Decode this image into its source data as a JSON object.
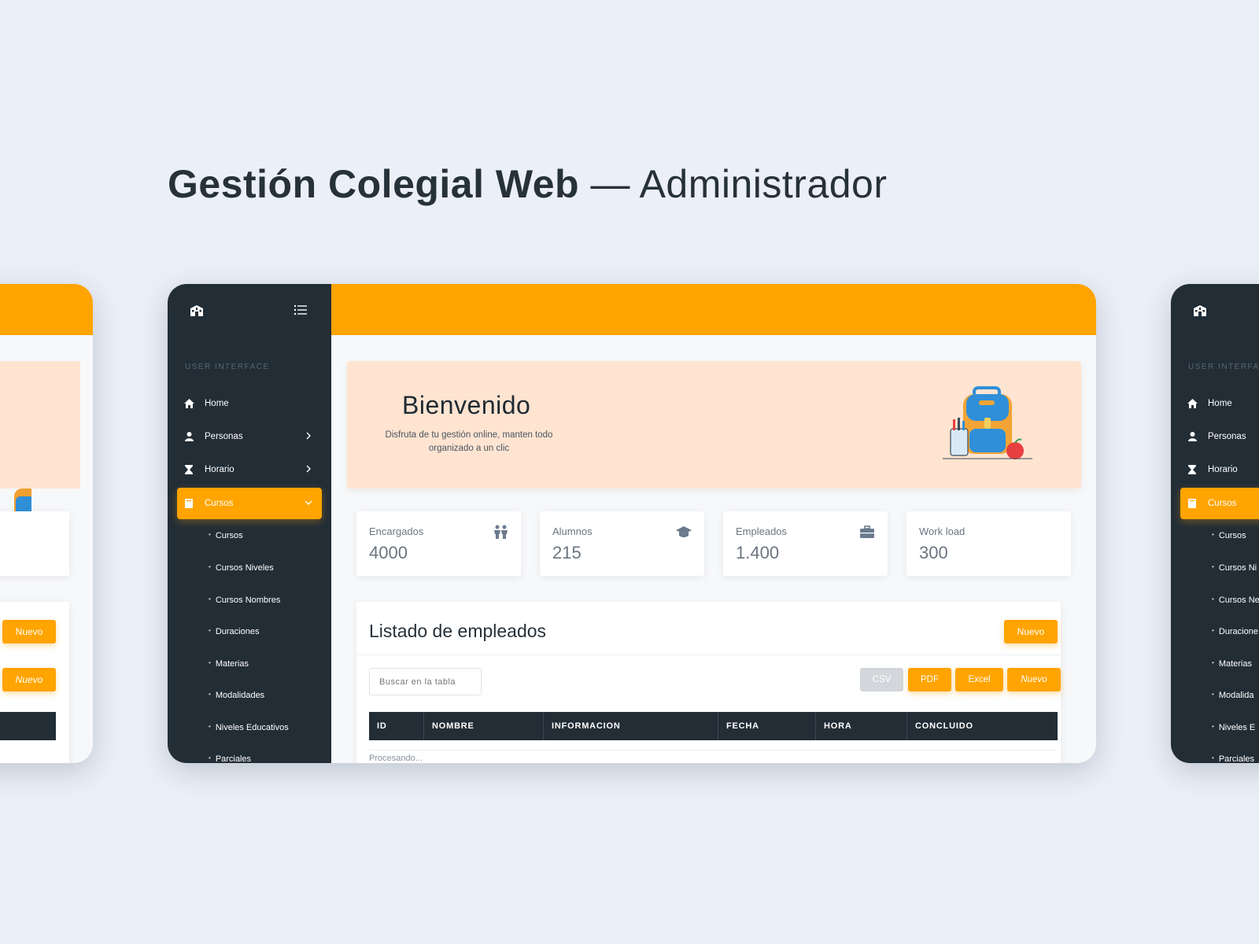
{
  "headline": {
    "strong": "Gestión Colegial Web",
    "light": " — Administrador"
  },
  "sidebar": {
    "section": "USER INTERFACE",
    "items": [
      {
        "label": "Home",
        "icon": "home-icon"
      },
      {
        "label": "Personas",
        "icon": "user-icon"
      },
      {
        "label": "Horario",
        "icon": "hourglass-icon"
      },
      {
        "label": "Cursos",
        "icon": "book-icon"
      }
    ],
    "subitems": [
      "Cursos",
      "Cursos Niveles",
      "Cursos Nombres",
      "Duraciones",
      "Materias",
      "Modalidades",
      "Niveles Educativos",
      "Parciales"
    ]
  },
  "right_sidebar_items": {
    "subitems": [
      "Cursos",
      "Cursos Ni",
      "Cursos Ne",
      "Duracione",
      "Materias",
      "Modalida",
      "Niveles E",
      "Parciales"
    ],
    "section": "USER INTERFAC"
  },
  "welcome": {
    "title": "Bienvenido",
    "subtitle": "Disfruta de tu gestión online, manten todo organizado a un clic"
  },
  "stats": [
    {
      "label": "Encargados",
      "value": "4000",
      "icon": "parents-icon"
    },
    {
      "label": "Alumnos",
      "value": "215",
      "icon": "graduation-cap-icon"
    },
    {
      "label": "Empleados",
      "value": "1.400",
      "icon": "briefcase-icon"
    },
    {
      "label": "Work load",
      "value": "300",
      "icon": ""
    }
  ],
  "employees": {
    "title": "Listado de empleados",
    "new_label": "Nuevo",
    "search_placeholder": "Buscar en la tabla",
    "export": {
      "csv": "CSV",
      "pdf": "PDF",
      "excel": "Excel",
      "nuevo": "Nuevo"
    },
    "columns": [
      "ID",
      "NOMBRE",
      "INFORMACION",
      "FECHA",
      "HORA",
      "CONCLUIDO"
    ],
    "processing": "Procesando..."
  },
  "left_preview": {
    "btn1": "Nuevo",
    "btn2": "Nuevo"
  },
  "colors": {
    "accent": "#ffa400",
    "sidebar": "#222d36",
    "welcome_bg": "#ffe4d1",
    "page_bg": "#ebeff7"
  }
}
